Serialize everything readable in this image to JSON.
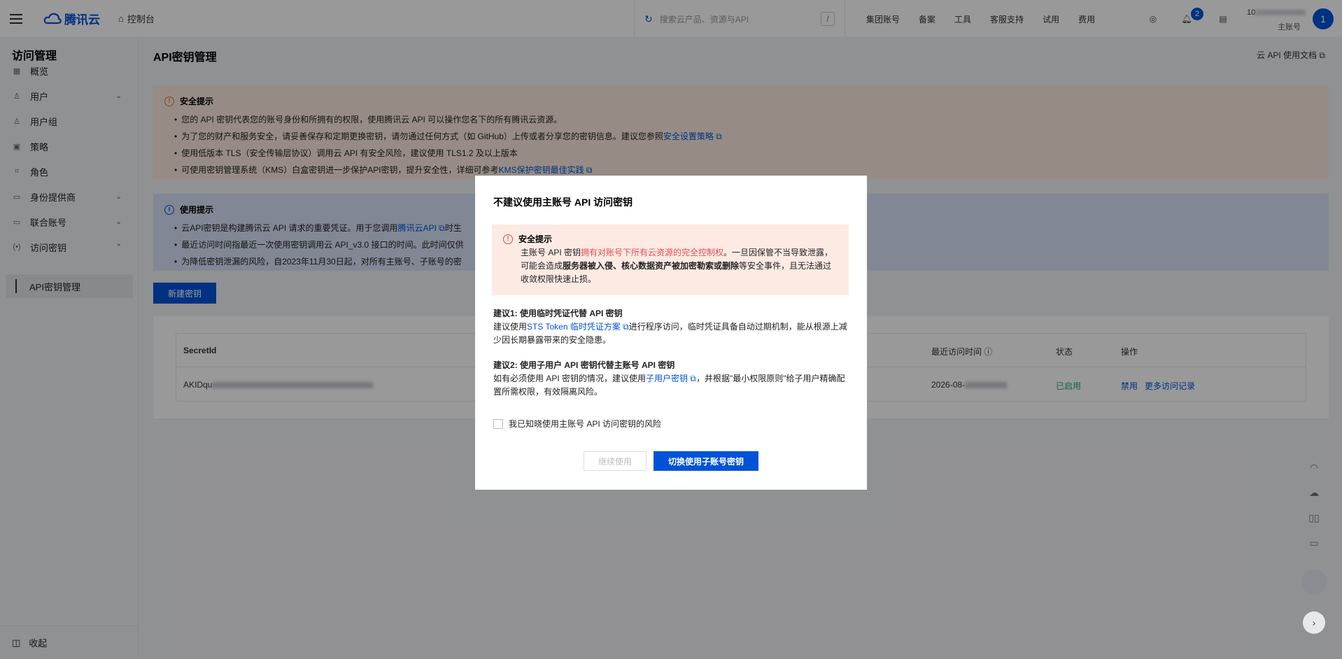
{
  "topbar": {
    "brand": "腾讯云",
    "console": "控制台",
    "search_placeholder": "搜索云产品、资源与API",
    "search_key": "/",
    "links": [
      "集团账号",
      "备案",
      "工具",
      "客服支持",
      "试用",
      "费用"
    ],
    "notification_count": "2",
    "account_id_prefix": "10",
    "account_type": "主账号",
    "avatar_letter": "1"
  },
  "sidebar": {
    "title": "访问管理",
    "items": [
      {
        "label": "概览",
        "icon": "grid-icon"
      },
      {
        "label": "用户",
        "icon": "user-icon",
        "expand": "⌄"
      },
      {
        "label": "用户组",
        "icon": "user-group-icon"
      },
      {
        "label": "策略",
        "icon": "policy-icon"
      },
      {
        "label": "角色",
        "icon": "role-icon"
      },
      {
        "label": "身份提供商",
        "icon": "idp-icon",
        "expand": "⌄"
      },
      {
        "label": "联合账号",
        "icon": "federated-icon",
        "expand": "⌄"
      },
      {
        "label": "访问密钥",
        "icon": "key-icon",
        "expand": "⌃"
      }
    ],
    "sub_item": "API密钥管理",
    "collapse": "收起"
  },
  "main": {
    "title": "API密钥管理",
    "doc_link": "云 API 使用文档",
    "security_tip": {
      "title": "安全提示",
      "items": [
        {
          "text": "您的 API 密钥代表您的账号身份和所拥有的权限，使用腾讯云 API 可以操作您名下的所有腾讯云资源。",
          "link": ""
        },
        {
          "text": "为了您的财产和服务安全，请妥善保存和定期更换密钥，请勿通过任何方式（如 GitHub）上传或者分享您的密钥信息。建议您参照",
          "link": "安全设置策略"
        },
        {
          "text": "使用低版本 TLS（安全传输层协议）调用云 API 有安全风险，建议使用 TLS1.2 及以上版本",
          "link": ""
        },
        {
          "text": "可使用密钥管理系统（KMS）白盒密钥进一步保护API密钥，提升安全性，详细可参考",
          "link": "KMS保护密钥最佳实践"
        }
      ]
    },
    "usage_tip": {
      "title": "使用提示",
      "items": [
        {
          "text": "云API密钥是构建腾讯云 API 请求的重要凭证。用于您调用",
          "link": "腾讯云API",
          "after": "时生"
        },
        {
          "text": "最近访问时间指最近一次使用密钥调用云 API_v3.0 接口的时间。此时间仅供",
          "link": "",
          "after": ""
        },
        {
          "text": "为降低密钥泄漏的风险，自2023年11月30日起，对所有主账号、子账号的密",
          "link": "",
          "after": ""
        }
      ]
    },
    "new_key_button": "新建密钥",
    "table": {
      "headers": {
        "secret_id": "SecretId",
        "last_access": "最近访问时间",
        "status": "状态",
        "actions": "操作"
      },
      "row": {
        "secret_id_prefix": "AKIDqu",
        "last_access_prefix": "2026-08-",
        "status": "已启用",
        "action_disable": "禁用",
        "action_more": "更多访问记录"
      }
    }
  },
  "modal": {
    "title": "不建议使用主账号 API 访问密钥",
    "alert_title": "安全提示",
    "alert_p1": "主账号 API 密钥",
    "alert_red": "拥有对账号下所有云资源的完全控制权",
    "alert_p2": "。一旦因保管不当导致泄露，可能会造成",
    "alert_bold": "服务器被入侵、核心数据资产被加密勒索或删除",
    "alert_p3": "等安全事件，且无法通过收敛权限快速止损。",
    "s1_title": "建议1: 使用临时凭证代替 API 密钥",
    "s1_pre": "建议使用",
    "s1_link": "STS Token 临时凭证方案",
    "s1_post": "进行程序访问，临时凭证具备自动过期机制，能从根源上减少因长期暴露带来的安全隐患。",
    "s2_title": "建议2: 使用子用户 API 密钥代替主账号 API 密钥",
    "s2_pre": "如有必须使用 API 密钥的情况，建议使用",
    "s2_link": "子用户密钥",
    "s2_post": "，并根据\"最小权限原则\"给子用户精确配置所需权限，有效隔离风险。",
    "checkbox_label": "我已知晓使用主账号 API 访问密钥的风险",
    "btn_continue": "继续使用",
    "btn_switch": "切换使用子账号密钥"
  },
  "colors": {
    "brand": "#0052d9",
    "warn_bg": "#fbe9de",
    "info_bg": "#d7e1f7",
    "danger": "#e34d59",
    "enabled": "#2ba471"
  }
}
